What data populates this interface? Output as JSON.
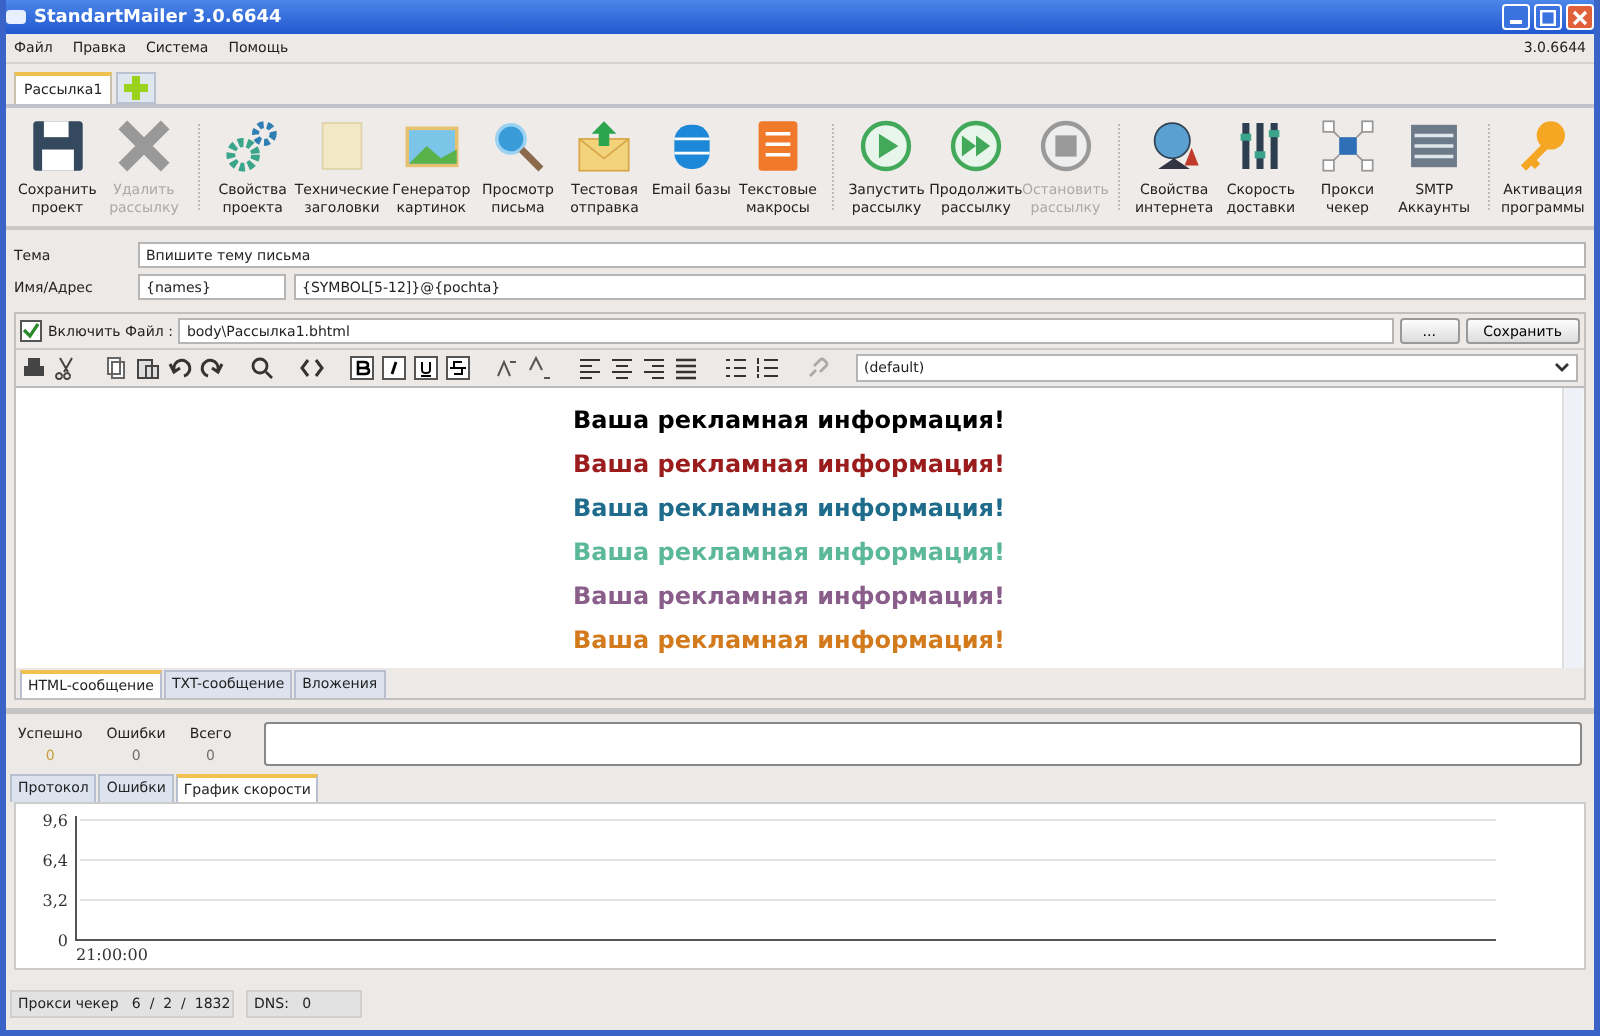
{
  "window": {
    "title": "StandartMailer 3.0.6644",
    "version": "3.0.6644"
  },
  "menu": [
    {
      "label": "Файл"
    },
    {
      "label": "Правка"
    },
    {
      "label": "Система"
    },
    {
      "label": "Помощь"
    }
  ],
  "project_tabs": [
    {
      "label": "Рассылка1",
      "selected": true
    }
  ],
  "toolbar": {
    "groups": [
      [
        {
          "kind": "save",
          "label": "Сохранить проект",
          "disabled": false
        },
        {
          "kind": "delete",
          "label": "Удалить рассылку",
          "disabled": true
        }
      ],
      [
        {
          "kind": "gears",
          "label": "Свойства проекта",
          "disabled": false
        },
        {
          "kind": "note",
          "label": "Технические заголовки",
          "disabled": false
        },
        {
          "kind": "picture",
          "label": "Генератор картинок",
          "disabled": false
        },
        {
          "kind": "magnifier",
          "label": "Просмотр письма",
          "disabled": false
        },
        {
          "kind": "envelope",
          "label": "Тестовая отправка",
          "disabled": false
        },
        {
          "kind": "database",
          "label": "Email базы",
          "disabled": false
        },
        {
          "kind": "list",
          "label": "Текстовые макросы",
          "disabled": false
        }
      ],
      [
        {
          "kind": "play",
          "label": "Запустить рассылку",
          "disabled": false
        },
        {
          "kind": "forward",
          "label": "Продолжить рассылку",
          "disabled": false
        },
        {
          "kind": "stop",
          "label": "Остановить рассылку",
          "disabled": true
        }
      ],
      [
        {
          "kind": "globe",
          "label": "Свойства интернета",
          "disabled": false
        },
        {
          "kind": "sliders",
          "label": "Скорость доставки",
          "disabled": false
        },
        {
          "kind": "network",
          "label": "Прокси чекер",
          "disabled": false
        },
        {
          "kind": "server",
          "label": "SMTP Аккаунты",
          "disabled": false
        }
      ],
      [
        {
          "kind": "key",
          "label": "Активация программы",
          "disabled": false
        }
      ]
    ]
  },
  "subject": {
    "label": "Тема",
    "value": "Впишите тему письма"
  },
  "address": {
    "label": "Имя/Адрес",
    "name_value": "{names}",
    "email_value": "{SYMBOL[5-12]}@{pochta}"
  },
  "include_file": {
    "label": "Включить Файл :",
    "checked": true,
    "path": "body\\Рассылка1.bhtml",
    "browse_button": "...",
    "save_button": "Сохранить"
  },
  "editor": {
    "font": "(default)",
    "lines": [
      {
        "text": "Ваша рекламная информация!",
        "color": "#000000"
      },
      {
        "text": "Ваша рекламная информация!",
        "color": "#9b1c1c"
      },
      {
        "text": "Ваша рекламная информация!",
        "color": "#1e6b8c"
      },
      {
        "text": "Ваша рекламная информация!",
        "color": "#5cb89b"
      },
      {
        "text": "Ваша рекламная информация!",
        "color": "#8a5e8a"
      },
      {
        "text": "Ваша рекламная информация!",
        "color": "#d27a1c"
      }
    ]
  },
  "message_tabs": [
    {
      "label": "HTML-сообщение",
      "selected": true
    },
    {
      "label": "TXT-сообщение",
      "selected": false
    },
    {
      "label": "Вложения",
      "selected": false
    }
  ],
  "stats": [
    {
      "label": "Успешно",
      "value": "0",
      "color": "#c8a040"
    },
    {
      "label": "Ошибки",
      "value": "0",
      "color": "#707070"
    },
    {
      "label": "Всего",
      "value": "0",
      "color": "#707070"
    }
  ],
  "log_tabs": [
    {
      "label": "Протокол",
      "selected": false
    },
    {
      "label": "Ошибки",
      "selected": false
    },
    {
      "label": "График скорости",
      "selected": true
    }
  ],
  "speed_chart": {
    "y_labels": [
      "9,6",
      "6,4",
      "3,2",
      "0"
    ],
    "time_label": "21:00:00"
  },
  "status_bar": {
    "proxy": "Прокси чекер   6  /  2  /  1832",
    "dns": "DNS:   0"
  }
}
